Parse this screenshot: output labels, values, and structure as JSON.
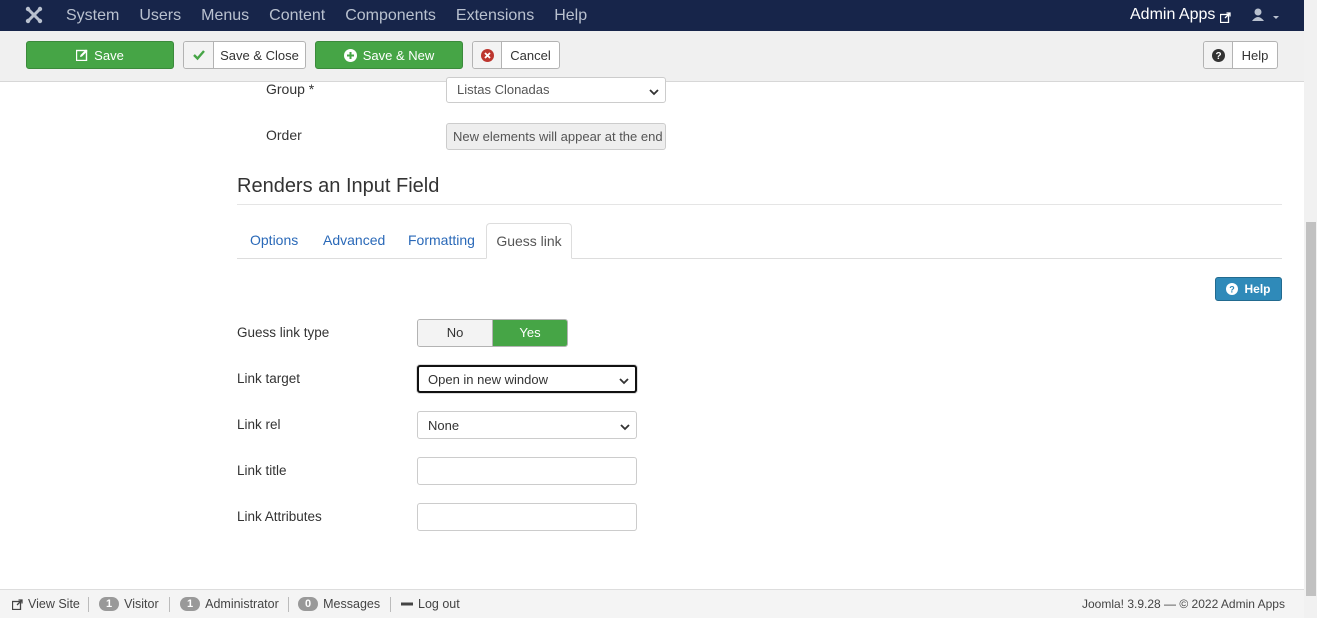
{
  "navbar": {
    "menu": [
      "System",
      "Users",
      "Menus",
      "Content",
      "Components",
      "Extensions",
      "Help"
    ],
    "brand": "Admin Apps"
  },
  "toolbar": {
    "save": "Save",
    "save_close": "Save & Close",
    "save_new": "Save & New",
    "cancel": "Cancel",
    "help": "Help"
  },
  "form_top": {
    "group_label": "Group *",
    "group_value": "Listas Clonadas",
    "order_label": "Order",
    "order_value": "New elements will appear at the end"
  },
  "section": {
    "title": "Renders an Input Field",
    "tabs": [
      {
        "label": "Options"
      },
      {
        "label": "Advanced"
      },
      {
        "label": "Formatting"
      },
      {
        "label": "Guess link"
      }
    ],
    "active_tab": "Guess link",
    "help": "Help"
  },
  "fields": {
    "guess_link_type": {
      "label": "Guess link type",
      "no": "No",
      "yes": "Yes",
      "selected": "Yes"
    },
    "link_target": {
      "label": "Link target",
      "value": "Open in new window"
    },
    "link_rel": {
      "label": "Link rel",
      "value": "None"
    },
    "link_title": {
      "label": "Link title",
      "value": ""
    },
    "link_attributes": {
      "label": "Link Attributes",
      "value": ""
    }
  },
  "statusbar": {
    "view_site": "View Site",
    "visitor_count": "1",
    "visitor_label": "Visitor",
    "admin_count": "1",
    "admin_label": "Administrator",
    "messages_count": "0",
    "messages_label": "Messages",
    "logout": "Log out",
    "footer": "Joomla! 3.9.28 — © 2022 Admin Apps"
  },
  "colors": {
    "navbar": "#17254a",
    "green": "#46a546",
    "help_blue": "#2f8ab9",
    "tab_link": "#2a69b8"
  },
  "icons": [
    "joomla-logo-icon",
    "edit-icon",
    "check-icon",
    "plus-circle-icon",
    "cancel-icon",
    "question-icon",
    "user-icon",
    "external-link-icon",
    "minus-icon"
  ]
}
